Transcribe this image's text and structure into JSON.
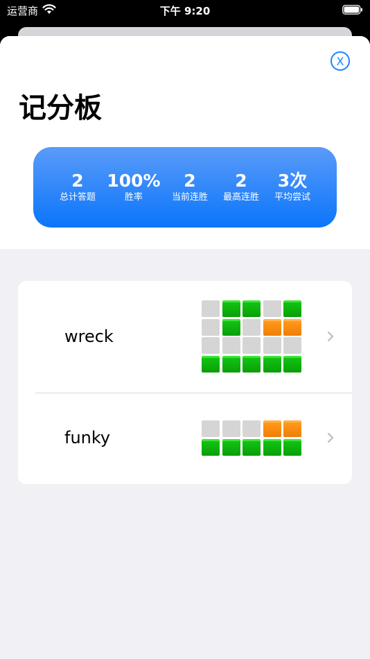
{
  "status_bar": {
    "carrier": "运营商",
    "time": "下午 9:20"
  },
  "close_button": {
    "label": "X"
  },
  "title": "记分板",
  "stats": [
    {
      "value": "2",
      "label": "总计答题"
    },
    {
      "value": "100%",
      "label": "胜率"
    },
    {
      "value": "2",
      "label": "当前连胜"
    },
    {
      "value": "2",
      "label": "最高连胜"
    },
    {
      "value": "3次",
      "label": "平均尝试"
    }
  ],
  "history": [
    {
      "word": "wreck",
      "grid": [
        [
          "e",
          "g",
          "g",
          "e",
          "g"
        ],
        [
          "e",
          "g",
          "e",
          "o",
          "o"
        ],
        [
          "e",
          "e",
          "e",
          "e",
          "e"
        ],
        [
          "g",
          "g",
          "g",
          "g",
          "g"
        ]
      ]
    },
    {
      "word": "funky",
      "grid": [
        [
          "e",
          "e",
          "e",
          "o",
          "o"
        ],
        [
          "g",
          "g",
          "g",
          "g",
          "g"
        ]
      ]
    }
  ],
  "colors": {
    "accent": "#1a84ff",
    "green": "#0fb10e",
    "orange": "#fb8a0c",
    "empty": "#d5d5d5"
  },
  "icons": [
    "wifi-icon",
    "battery-icon",
    "close-icon",
    "chevron-right-icon"
  ]
}
